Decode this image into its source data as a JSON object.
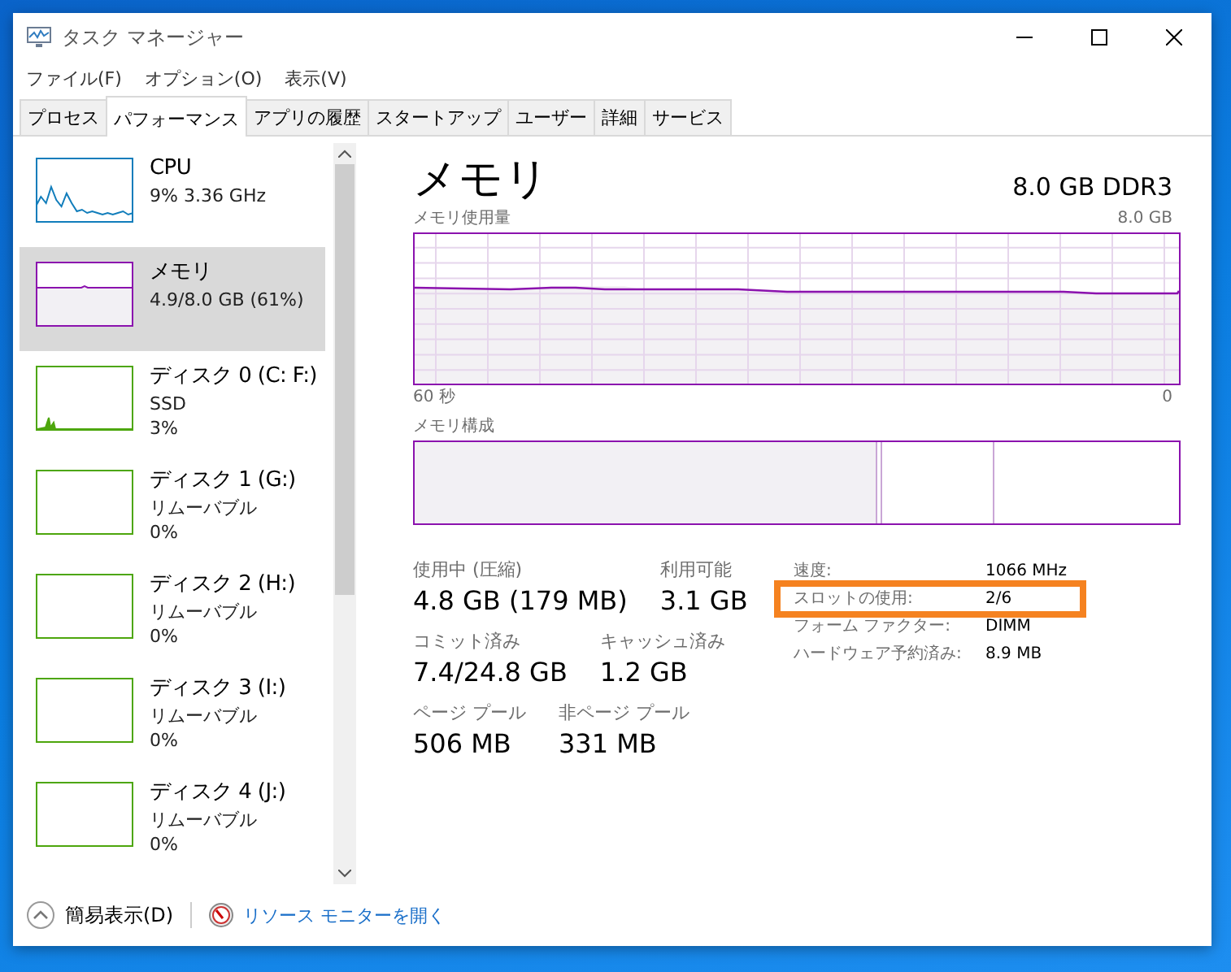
{
  "window": {
    "title": "タスク マネージャー"
  },
  "menu": [
    "ファイル(F)",
    "オプション(O)",
    "表示(V)"
  ],
  "tabs": [
    {
      "label": "プロセス",
      "selected": false
    },
    {
      "label": "パフォーマンス",
      "selected": true
    },
    {
      "label": "アプリの履歴",
      "selected": false
    },
    {
      "label": "スタートアップ",
      "selected": false
    },
    {
      "label": "ユーザー",
      "selected": false
    },
    {
      "label": "詳細",
      "selected": false
    },
    {
      "label": "サービス",
      "selected": false
    }
  ],
  "sidebar": {
    "items": [
      {
        "title": "CPU",
        "lines": [
          "9%  3.36 GHz"
        ],
        "color": "#117dbb",
        "kind": "wave",
        "selected": false
      },
      {
        "title": "メモリ",
        "lines": [
          "4.9/8.0 GB (61%)"
        ],
        "color": "#8b12ae",
        "kind": "flat",
        "selected": true
      },
      {
        "title": "ディスク 0 (C: F:)",
        "lines": [
          "SSD",
          "3%"
        ],
        "color": "#4da60c",
        "kind": "spike",
        "selected": false
      },
      {
        "title": "ディスク 1 (G:)",
        "lines": [
          "リムーバブル",
          "0%"
        ],
        "color": "#4da60c",
        "kind": "empty",
        "selected": false
      },
      {
        "title": "ディスク 2 (H:)",
        "lines": [
          "リムーバブル",
          "0%"
        ],
        "color": "#4da60c",
        "kind": "empty",
        "selected": false
      },
      {
        "title": "ディスク 3 (I:)",
        "lines": [
          "リムーバブル",
          "0%"
        ],
        "color": "#4da60c",
        "kind": "empty",
        "selected": false
      },
      {
        "title": "ディスク 4 (J:)",
        "lines": [
          "リムーバブル",
          "0%"
        ],
        "color": "#4da60c",
        "kind": "empty",
        "selected": false
      }
    ]
  },
  "main": {
    "title": "メモリ",
    "capacity": "8.0 GB DDR3",
    "usage_graph": {
      "label": "メモリ使用量",
      "max": "8.0 GB",
      "x_start": "60 秒",
      "x_end": "0"
    },
    "composition": {
      "label": "メモリ構成"
    },
    "stats": [
      [
        {
          "label": "使用中 (圧縮)",
          "value": "4.8 GB (179 MB)"
        },
        {
          "label": "利用可能",
          "value": "3.1 GB"
        }
      ],
      [
        {
          "label": "コミット済み",
          "value": "7.4/24.8 GB"
        },
        {
          "label": "キャッシュ済み",
          "value": "1.2 GB"
        }
      ],
      [
        {
          "label": "ページ プール",
          "value": "506 MB"
        },
        {
          "label": "非ページ プール",
          "value": "331 MB"
        }
      ]
    ],
    "details": [
      {
        "label": "速度:",
        "value": "1066 MHz",
        "highlighted": false
      },
      {
        "label": "スロットの使用:",
        "value": "2/6",
        "highlighted": true
      },
      {
        "label": "フォーム ファクター:",
        "value": "DIMM",
        "highlighted": false
      },
      {
        "label": "ハードウェア予約済み:",
        "value": "8.9 MB",
        "highlighted": false
      }
    ]
  },
  "footer": {
    "fewer_details": "簡易表示(D)",
    "resource_monitor": "リソース モニターを開く"
  }
}
